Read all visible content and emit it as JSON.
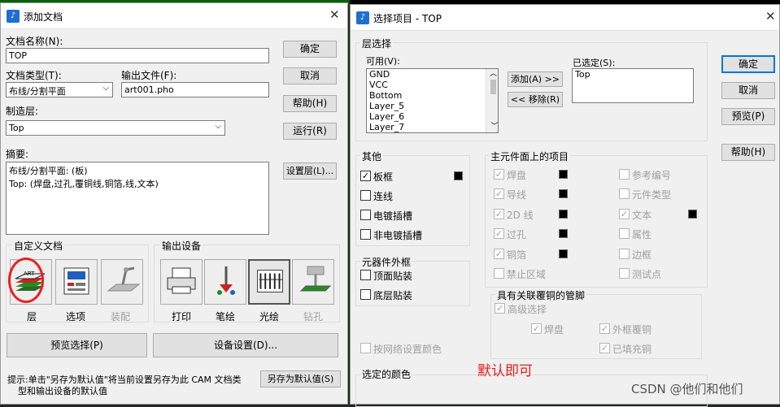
{
  "bg_strip": {
    "left_top": "#0a5f0a"
  },
  "dlg1": {
    "title": "添加文档",
    "doc_name_label": "文档名称(N):",
    "doc_name_value": "TOP",
    "doc_type_label": "文档类型(T):",
    "doc_type_value": "布线/分割平面",
    "output_file_label": "输出文件(F):",
    "output_file_value": "art001.pho",
    "layer_label": "制造层:",
    "layer_value": "Top",
    "summary_label": "摘要:",
    "summary_line1": "布线/分割平面: (板)",
    "summary_line2": "Top: (焊盘,过孔,覆铜线,铜箔,线,文本)",
    "btn_ok": "确定",
    "btn_cancel": "取消",
    "btn_help": "帮助(H)",
    "btn_run": "运行(R)",
    "btn_setlayer": "设置层(L)...",
    "custom_doc_group": "自定义文档",
    "output_dev_group": "输出设备",
    "icons": {
      "layer": "层",
      "options": "选项",
      "assembly": "装配",
      "print": "打印",
      "pen": "笔绘",
      "photo": "光绘",
      "drill": "钻孔"
    },
    "btn_preview_sel": "预览选择(P)",
    "btn_device_setup": "设备设置(D)...",
    "tip_line1": "提示:单击\"另存为默认值\"将当前设置另存为此 CAM 文档类",
    "tip_line2": "型和输出设备的默认值",
    "btn_save_default": "另存为默认值(S)"
  },
  "dlg2": {
    "title": "选择项目 - TOP",
    "layer_group": "层选择",
    "available_label": "可用(V):",
    "available": [
      "GND",
      "VCC",
      "Bottom",
      "Layer_5",
      "Layer_6",
      "Layer_7"
    ],
    "btn_add": "添加(A) >>",
    "btn_remove": "<< 移除(R)",
    "selected_label": "已选定(S):",
    "selected": [
      "Top"
    ],
    "btn_ok": "确定",
    "btn_cancel": "取消",
    "btn_preview": "预览(P)",
    "btn_help": "帮助(H)",
    "other_group": "其他",
    "other_items": [
      {
        "label": "板框",
        "checked": true,
        "swatch": true
      },
      {
        "label": "连线",
        "checked": false
      },
      {
        "label": "电镀插槽",
        "checked": false
      },
      {
        "label": "非电镀插槽",
        "checked": false
      }
    ],
    "outline_group": "元器件外框",
    "outline_items": [
      "顶面贴装",
      "底层贴装"
    ],
    "main_group": "主元件面上的项目",
    "main_left": [
      "焊盘",
      "导线",
      "2D 线",
      "过孔",
      "铜箔",
      "禁止区域"
    ],
    "main_right": [
      "参考编号",
      "元件类型",
      "文本",
      "属性",
      "边框",
      "测试点"
    ],
    "pins_group": "具有关联覆铜的管脚",
    "pins_advanced": "高级选择",
    "pins_pad": "焊盘",
    "pins_outline_copper": "外框覆铜",
    "pins_filled_copper": "已填充铜",
    "net_color": "按网络设置颜色",
    "selected_color": "选定的颜色",
    "annotation": "默认即可",
    "annotation_color": "#e81c1c",
    "watermark": "CSDN @他们和他们"
  }
}
